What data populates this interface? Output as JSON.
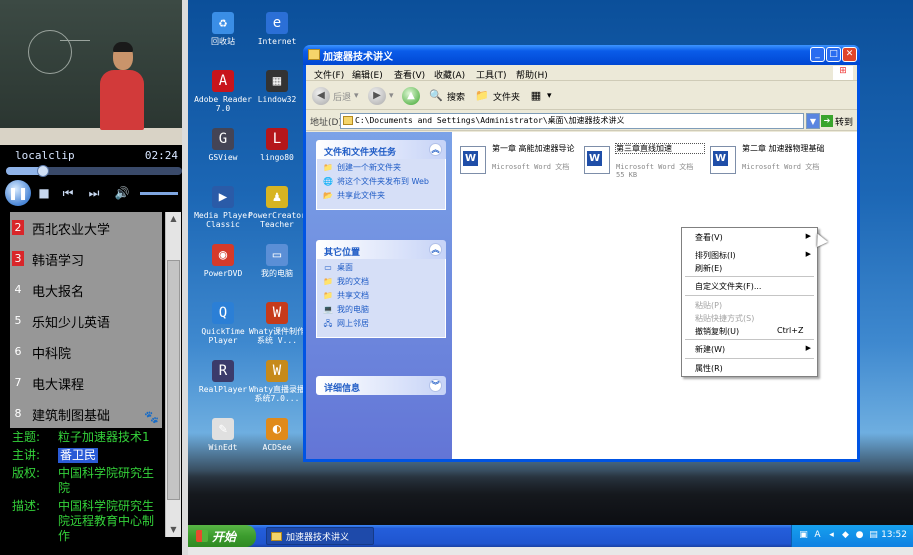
{
  "player": {
    "clip_name": "localclip",
    "clip_time": "02:24",
    "progress_fraction": 0.21,
    "channels": [
      {
        "num": "2",
        "label": "西北农业大学",
        "hot": true
      },
      {
        "num": "3",
        "label": "韩语学习",
        "hot": true
      },
      {
        "num": "4",
        "label": "电大报名",
        "hot": false
      },
      {
        "num": "5",
        "label": "乐知少儿英语",
        "hot": false
      },
      {
        "num": "6",
        "label": "中科院",
        "hot": false
      },
      {
        "num": "7",
        "label": "电大课程",
        "hot": false
      },
      {
        "num": "8",
        "label": "建筑制图基础",
        "hot": false
      }
    ],
    "meta": {
      "topic_key": "主题:",
      "topic_val": "粒子加速器技术1",
      "speaker_key": "主讲:",
      "speaker_val": "番卫民",
      "copyright_key": "版权:",
      "copyright_val": "中国科学院研究生院",
      "desc_key": "描述:",
      "desc_val": "中国科学院研究生院远程教育中心制作"
    }
  },
  "desktop": {
    "icons": [
      {
        "name": "recycle-bin-icon",
        "label": "回收站",
        "glyph": "♻",
        "color": "#3a8ee6"
      },
      {
        "name": "internet-icon",
        "label": "Internet",
        "glyph": "e",
        "color": "#2b6fd6"
      },
      {
        "name": "adobe-reader-icon",
        "label": "Adobe Reader 7.0",
        "glyph": "A",
        "color": "#c8141c"
      },
      {
        "name": "lindow32-icon",
        "label": "Lindow32",
        "glyph": "▦",
        "color": "#333333"
      },
      {
        "name": "gsview-icon",
        "label": "GSView",
        "glyph": "G",
        "color": "#445"
      },
      {
        "name": "lingo80-icon",
        "label": "lingo80",
        "glyph": "L",
        "color": "#b5161b"
      },
      {
        "name": "media-player-classic-icon",
        "label": "Media Player Classic",
        "glyph": "▶",
        "color": "#2a5ba8"
      },
      {
        "name": "powercreator-teacher-icon",
        "label": "PowerCreator Teacher",
        "glyph": "♟",
        "color": "#d7b422"
      },
      {
        "name": "powerdvd-icon",
        "label": "PowerDVD",
        "glyph": "◉",
        "color": "#d53a2a"
      },
      {
        "name": "my-computer-icon",
        "label": "我的电脑",
        "glyph": "▭",
        "color": "#5b8fd6"
      },
      {
        "name": "quicktime-player-icon",
        "label": "QuickTime Player",
        "glyph": "Q",
        "color": "#2b7fd6"
      },
      {
        "name": "whaty-courseware-icon",
        "label": "Whaty课件制作系统 V...",
        "glyph": "W",
        "color": "#c63a1a"
      },
      {
        "name": "realplayer-icon",
        "label": "RealPlayer",
        "glyph": "R",
        "color": "#3b3b6b"
      },
      {
        "name": "whaty-recording-icon",
        "label": "Whaty直播录播系统7.0...",
        "glyph": "W",
        "color": "#c68a1a"
      },
      {
        "name": "winedt-icon",
        "label": "WinEdt",
        "glyph": "✎",
        "color": "#e0e0e0"
      },
      {
        "name": "acdsee-icon",
        "label": "ACDSee",
        "glyph": "◐",
        "color": "#e08a1a"
      }
    ]
  },
  "window": {
    "title": "加速器技术讲义",
    "menus": [
      "文件(F)",
      "编辑(E)",
      "查看(V)",
      "收藏(A)",
      "工具(T)",
      "帮助(H)"
    ],
    "toolbar": {
      "back": "后退",
      "search": "搜索",
      "folders": "文件夹"
    },
    "address_label": "地址(D)",
    "address_value": "C:\\Documents and Settings\\Administrator\\桌面\\加速器技术讲义",
    "go_label": "转到",
    "tasks_group": {
      "title": "文件和文件夹任务",
      "items": [
        "创建一个新文件夹",
        "将这个文件夹发布到 Web",
        "共享此文件夹"
      ]
    },
    "places_group": {
      "title": "其它位置",
      "items": [
        "桌面",
        "我的文档",
        "共享文档",
        "我的电脑",
        "网上邻居"
      ]
    },
    "details_group": {
      "title": "详细信息"
    },
    "files": [
      {
        "name": "第一章 高能加速器导论",
        "type": "Microsoft Word 文档"
      },
      {
        "name": "第三章直线加速",
        "type": "Microsoft Word 文档 55 KB"
      },
      {
        "name": "第二章 加速器物理基础",
        "type": "Microsoft Word 文档"
      }
    ]
  },
  "context_menu": {
    "items": [
      {
        "label": "查看(V)",
        "arrow": true,
        "disabled": false
      },
      {
        "label": "排列图标(I)",
        "arrow": true,
        "disabled": false
      },
      {
        "label": "刷新(E)",
        "arrow": false,
        "disabled": false
      },
      {
        "label": "自定义文件夹(F)...",
        "arrow": false,
        "disabled": false
      },
      {
        "label": "粘贴(P)",
        "arrow": false,
        "disabled": true
      },
      {
        "label": "粘贴快捷方式(S)",
        "arrow": false,
        "disabled": true
      },
      {
        "label": "撤销复制(U)",
        "arrow": false,
        "disabled": false,
        "shortcut": "Ctrl+Z"
      },
      {
        "label": "新建(W)",
        "arrow": true,
        "disabled": false
      },
      {
        "label": "属性(R)",
        "arrow": false,
        "disabled": false
      }
    ]
  },
  "taskbar": {
    "start_label": "开始",
    "task_label": "加速器技术讲义",
    "clock": "13:52"
  }
}
